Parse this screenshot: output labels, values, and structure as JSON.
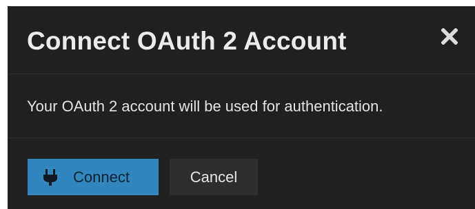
{
  "dialog": {
    "title": "Connect OAuth 2 Account",
    "close_icon": "close-icon",
    "message": "Your OAuth 2 account will be used for authentication.",
    "buttons": {
      "connect": {
        "label": "Connect",
        "icon": "plug-icon"
      },
      "cancel": {
        "label": "Cancel"
      }
    }
  },
  "colors": {
    "dialog_background": "#202020",
    "primary_button": "#3187bd",
    "secondary_button": "#2e2e2e",
    "divider": "#2e2e2e"
  }
}
